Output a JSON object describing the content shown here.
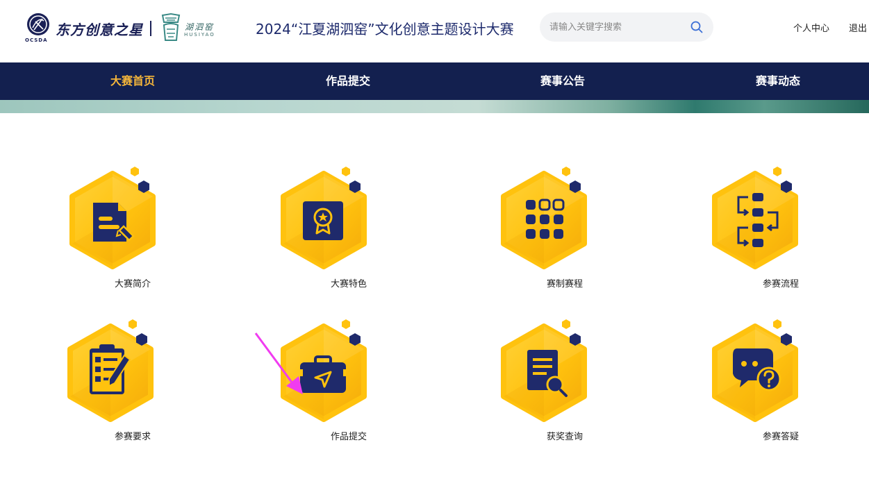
{
  "header": {
    "logo_text": "东方创意之星",
    "logo_emblem_text": "OCSDA",
    "logo2_cn": "湖泗窑",
    "logo2_en": "HUSIYAO",
    "title": "2024“江夏湖泗窑”文化创意主题设计大赛",
    "search_placeholder": "请输入关键字搜索",
    "user_center": "个人中心",
    "logout": "退出"
  },
  "nav": {
    "items": [
      {
        "label": "大赛首页",
        "active": true
      },
      {
        "label": "作品提交",
        "active": false
      },
      {
        "label": "赛事公告",
        "active": false
      },
      {
        "label": "赛事动态",
        "active": false
      }
    ]
  },
  "cards": [
    {
      "label": "大赛简介",
      "icon": "document-edit-icon"
    },
    {
      "label": "大赛特色",
      "icon": "award-badge-icon"
    },
    {
      "label": "赛制赛程",
      "icon": "grid-dots-icon"
    },
    {
      "label": "参赛流程",
      "icon": "flow-process-icon"
    },
    {
      "label": "参赛要求",
      "icon": "clipboard-pen-icon"
    },
    {
      "label": "作品提交",
      "icon": "briefcase-send-icon"
    },
    {
      "label": "获奖查询",
      "icon": "document-search-icon"
    },
    {
      "label": "参赛答疑",
      "icon": "chat-question-icon"
    }
  ],
  "colors": {
    "nav_bg": "#13204f",
    "nav_active": "#f5b63a",
    "hex_yellow": "#ffc20e",
    "icon_navy": "#1f2a6b",
    "arrow_magenta": "#f03cf0"
  }
}
